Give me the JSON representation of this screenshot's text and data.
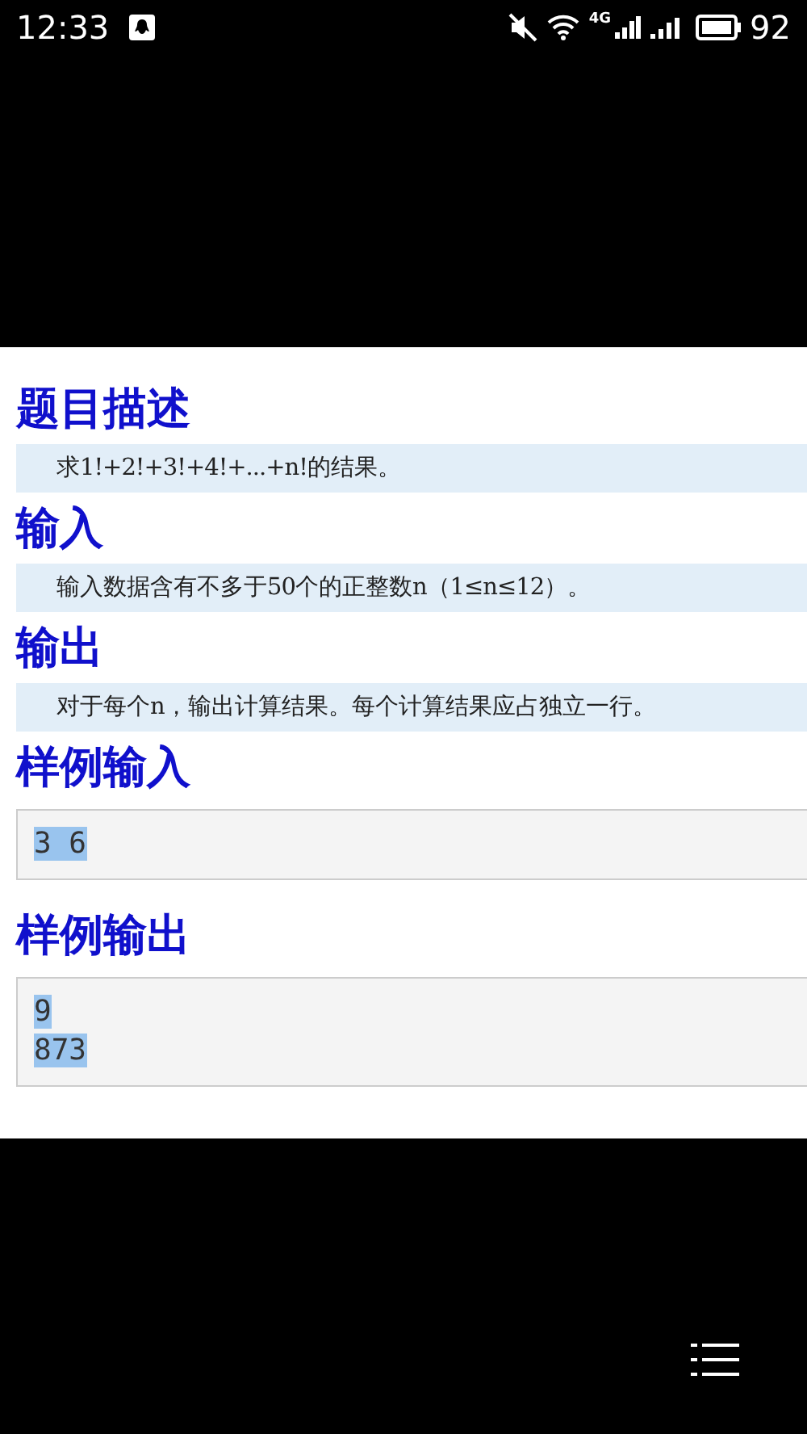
{
  "status_bar": {
    "time": "12:33",
    "network_label": "4G",
    "battery": "92"
  },
  "sections": [
    {
      "heading": "题目描述",
      "kind": "text",
      "text": "求1!+2!+3!+4!+...+n!的结果。"
    },
    {
      "heading": "输入",
      "kind": "text",
      "text": "输入数据含有不多于50个的正整数n（1≤n≤12）。"
    },
    {
      "heading": "输出",
      "kind": "text",
      "text": "对于每个n，输出计算结果。每个计算结果应占独立一行。"
    },
    {
      "heading": "样例输入",
      "kind": "sample",
      "highlighted": true,
      "lines": [
        "3 6"
      ]
    },
    {
      "heading": "样例输出",
      "kind": "sample",
      "highlighted": true,
      "lines": [
        "9",
        "873"
      ]
    }
  ]
}
